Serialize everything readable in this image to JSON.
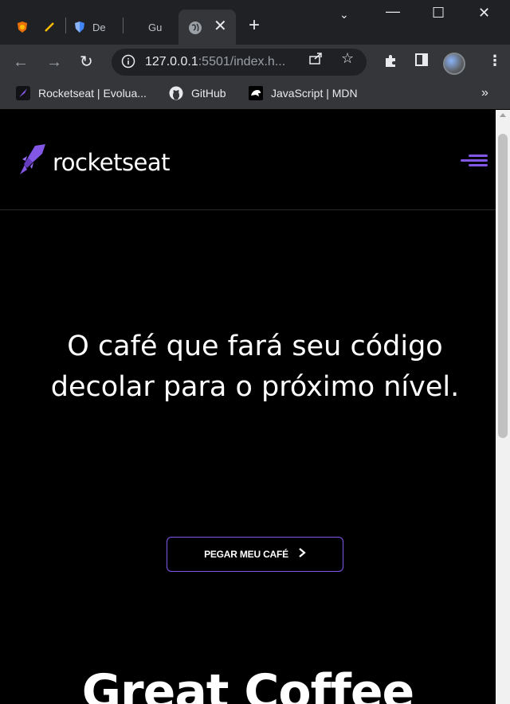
{
  "browser": {
    "tabs": [
      {
        "title": "",
        "icon": "shield-orange-icon"
      },
      {
        "title": "",
        "icon": "pencil-icon"
      },
      {
        "title": "De",
        "icon": "shield-blue-icon"
      },
      {
        "title": "Gu",
        "icon": ""
      },
      {
        "title": "",
        "icon": "globe-icon",
        "active": true
      }
    ],
    "url_host": "127.0.0.1",
    "url_rest": ":5501/index.h...",
    "bookmarks": [
      {
        "label": "Rocketseat | Evolua...",
        "icon": "rocketseat-icon"
      },
      {
        "label": "GitHub",
        "icon": "github-icon"
      },
      {
        "label": "JavaScript | MDN",
        "icon": "mdn-icon"
      }
    ]
  },
  "site": {
    "logo_text": "rocketseat",
    "hero_title": "O café que fará seu código decolar para o próximo nível.",
    "cta_label": "PEGAR MEU CAFÉ",
    "section_title": "Great Coffee",
    "accent_color": "#8257e5"
  }
}
